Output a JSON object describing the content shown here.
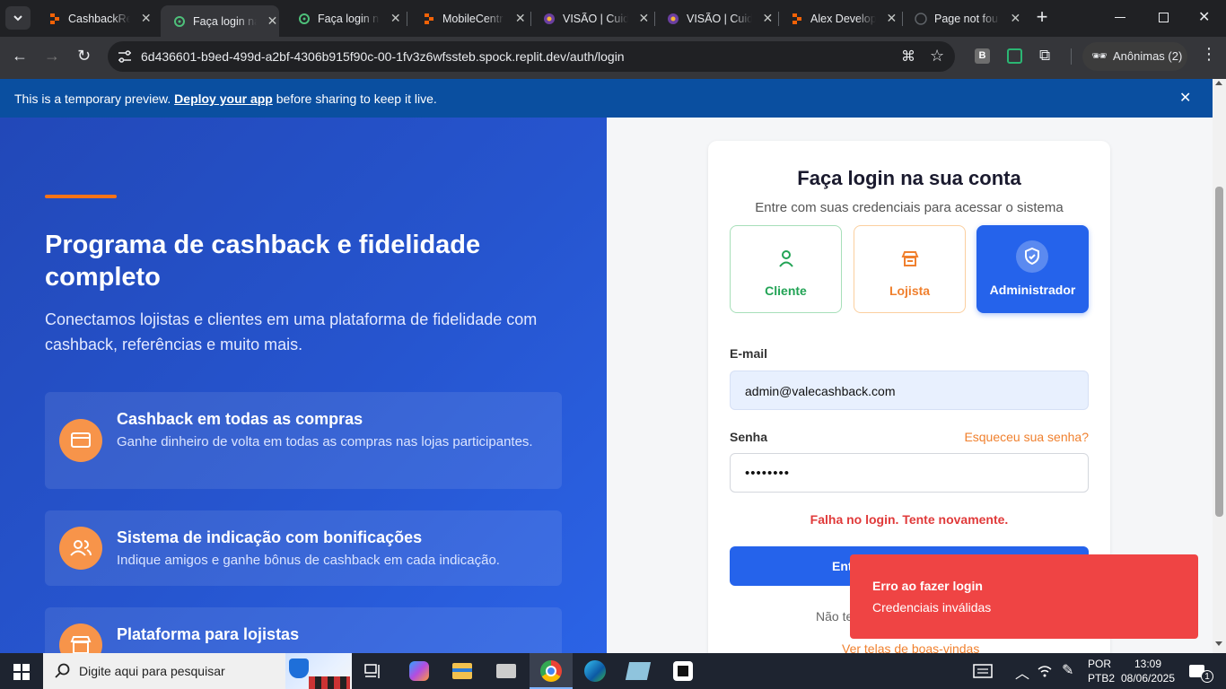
{
  "browser": {
    "tabs": [
      {
        "title": "CashbackRef",
        "favicon": "replit-icon",
        "active": false
      },
      {
        "title": "Faça login na",
        "favicon": "globe-green-icon",
        "active": true
      },
      {
        "title": "Faça login na",
        "favicon": "globe-green-icon",
        "active": false
      },
      {
        "title": "MobileCentr",
        "favicon": "replit-icon",
        "active": false
      },
      {
        "title": "VISÃO | Cuid",
        "favicon": "visao-icon",
        "active": false
      },
      {
        "title": "VISÃO | Cuid",
        "favicon": "visao-icon",
        "active": false
      },
      {
        "title": "Alex Develop",
        "favicon": "replit-icon",
        "active": false
      },
      {
        "title": "Page not fou",
        "favicon": "github-icon",
        "active": false
      }
    ],
    "url": "6d436601-b9ed-499d-a2bf-4306b915f90c-00-1fv3z6wfssteb.spock.replit.dev/auth/login",
    "profile_label": "Anônimas (2)",
    "ext_b_label": "B"
  },
  "banner": {
    "text_before": "This is a temporary preview. ",
    "link": "Deploy your app",
    "text_after": " before sharing to keep it live."
  },
  "hero": {
    "title": "Programa de cashback e fidelidade completo",
    "subtitle": "Conectamos lojistas e clientes em uma plataforma de fidelidade com cashback, referências e muito mais.",
    "features": [
      {
        "title": "Cashback em todas as compras",
        "desc": "Ganhe dinheiro de volta em todas as compras nas lojas participantes.",
        "icon": "credit-card-icon"
      },
      {
        "title": "Sistema de indicação com bonificações",
        "desc": "Indique amigos e ganhe bônus de cashback em cada indicação.",
        "icon": "users-icon"
      },
      {
        "title": "Plataforma para lojistas",
        "desc": "",
        "icon": "store-icon"
      }
    ]
  },
  "login": {
    "title": "Faça login na sua conta",
    "subtitle": "Entre com suas credenciais para acessar o sistema",
    "roles": [
      {
        "label": "Cliente",
        "icon": "user-icon",
        "selected": false
      },
      {
        "label": "Lojista",
        "icon": "store-icon",
        "selected": false
      },
      {
        "label": "Administrador",
        "icon": "shield-check-icon",
        "selected": true
      }
    ],
    "email_label": "E-mail",
    "email_value": "admin@valecashback.com",
    "password_label": "Senha",
    "forgot_label": "Esqueceu sua senha?",
    "password_value": "••••••••",
    "error_text": "Falha no login. Tente novamente.",
    "submit_label": "Ent",
    "signup_prefix": "Não te",
    "welcome_link": "Ver telas de boas-vindas"
  },
  "toast": {
    "title": "Erro ao fazer login",
    "message": "Credenciais inválidas"
  },
  "taskbar": {
    "search_placeholder": "Digite aqui para pesquisar",
    "lang_top": "POR",
    "lang_bottom": "PTB2",
    "time": "13:09",
    "date": "08/06/2025",
    "notification_count": "1"
  },
  "colors": {
    "brand_blue": "#2563eb",
    "accent_orange": "#f97316",
    "cliente_green": "#22a355",
    "error_red": "#ef4444"
  }
}
